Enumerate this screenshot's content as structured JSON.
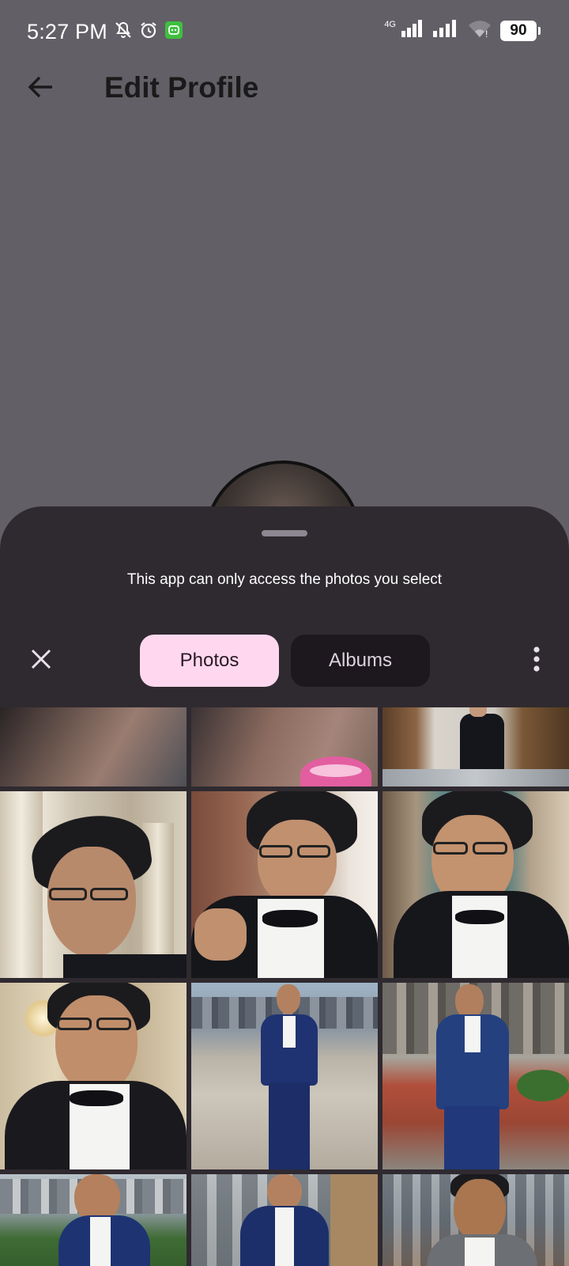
{
  "status_bar": {
    "time": "5:27 PM",
    "left_icons": [
      "mute-icon",
      "alarm-icon",
      "app-notification-icon"
    ],
    "network_label": "4G",
    "battery": "90"
  },
  "header": {
    "title": "Edit Profile",
    "back_icon": "arrow-left-icon"
  },
  "sheet": {
    "notice": "This app can only access the photos you select",
    "tabs": [
      {
        "label": "Photos",
        "selected": true
      },
      {
        "label": "Albums",
        "selected": false
      }
    ],
    "close_icon": "close-icon",
    "more_icon": "more-vertical-icon"
  },
  "photos": [
    {
      "name": "photo-closeup-selfie-1",
      "bg": "#5b4e48"
    },
    {
      "name": "photo-closeup-selfie-2",
      "bg": "#6a5149"
    },
    {
      "name": "photo-tux-doorway",
      "bg": "#7b6a58"
    },
    {
      "name": "photo-tux-columns",
      "bg": "#c9bfae"
    },
    {
      "name": "photo-tux-hand-chin",
      "bg": "#7a5d50"
    },
    {
      "name": "photo-tux-window",
      "bg": "#8b7a66"
    },
    {
      "name": "photo-tux-chandelier",
      "bg": "#b8a98f"
    },
    {
      "name": "photo-navy-suit-rooftop",
      "bg": "#a8a49b"
    },
    {
      "name": "photo-navy-suit-terrace",
      "bg": "#9b8f84"
    },
    {
      "name": "photo-navy-suit-city-1",
      "bg": "#8d9aa3"
    },
    {
      "name": "photo-navy-suit-city-2",
      "bg": "#9aa0a3"
    },
    {
      "name": "photo-gray-suit-city",
      "bg": "#7f8a93"
    }
  ]
}
